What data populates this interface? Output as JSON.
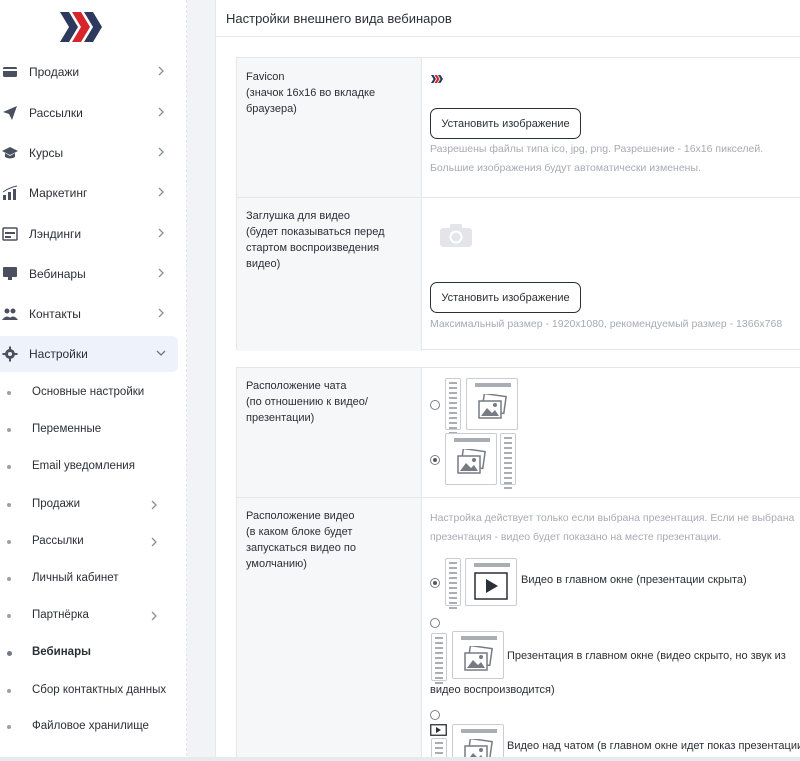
{
  "sidebar": {
    "items": [
      {
        "label": "Продажи",
        "icon": "wallet-icon"
      },
      {
        "label": "Рассылки",
        "icon": "paper-plane-icon"
      },
      {
        "label": "Курсы",
        "icon": "graduation-cap-icon"
      },
      {
        "label": "Маркетинг",
        "icon": "bar-chart-icon"
      },
      {
        "label": "Лэндинги",
        "icon": "landing-page-icon"
      },
      {
        "label": "Вебинары",
        "icon": "monitor-icon"
      },
      {
        "label": "Контакты",
        "icon": "users-icon"
      },
      {
        "label": "Настройки",
        "icon": "gear-icon"
      }
    ],
    "sub_items": [
      {
        "label": "Основные настройки"
      },
      {
        "label": "Переменные"
      },
      {
        "label": "Email уведомления"
      },
      {
        "label": "Продажи"
      },
      {
        "label": "Рассылки"
      },
      {
        "label": "Личный кабинет"
      },
      {
        "label": "Партнёрка"
      },
      {
        "label": "Вебинары"
      },
      {
        "label": "Сбор контактных данных"
      },
      {
        "label": "Файловое хранилище"
      }
    ]
  },
  "main": {
    "title": "Настройки внешнего вида вебинаров",
    "favicon": {
      "label": "Favicon",
      "sublabel": "(значок 16x16 во вкладке браузера)",
      "button": "Установить изображение",
      "hint_line1": "Разрешены файлы типа ico, jpg, png. Разрешение - 16x16 пикселей.",
      "hint_line2": "Большие изображения будут автоматически изменены."
    },
    "placeholder": {
      "label": "Заглушка для видео",
      "sublabel": "(будет показываться перед стартом воспроизведения видео)",
      "button": "Установить изображение",
      "hint": "Максимальный размер - 1920x1080, рекомендуемый размер - 1366x768"
    },
    "chat_position": {
      "label": "Расположение чата",
      "sublabel": "(по отношению к видео/презентации)",
      "selected": 2
    },
    "video_position": {
      "label": "Расположение видео",
      "sublabel": "(в каком блоке будет запускаться видео по умолчанию)",
      "hint_line1": "Настройка действует только если выбрана презентация. Если не выбрана",
      "hint_line2": "презентация - видео будет показано на месте презентации.",
      "options": [
        {
          "label": "Видео в главном окне (презентации скрыта)"
        },
        {
          "label": "Презентация в главном окне (видео скрыто, но звук из",
          "label_cont": "видео воспроизводится)"
        },
        {
          "label": "Видео над чатом (в главном окне идет показ презентации"
        }
      ],
      "selected": 1
    }
  },
  "colors": {
    "brand_dark": "#2d3a5e",
    "brand_red": "#d6252b",
    "active_bg": "#eef2fb"
  }
}
